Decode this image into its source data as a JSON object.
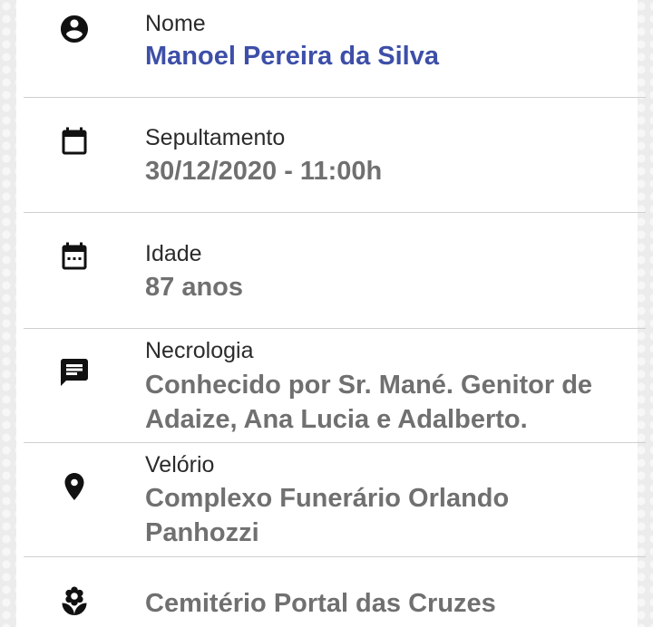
{
  "rows": [
    {
      "label": "Nome",
      "value": "Manoel Pereira da Silva",
      "icon": "account-circle-icon"
    },
    {
      "label": "Sepultamento",
      "value": "30/12/2020 - 11:00h",
      "icon": "calendar-icon"
    },
    {
      "label": "Idade",
      "value": "87 anos",
      "icon": "calendar-dots-icon"
    },
    {
      "label": "Necrologia",
      "value": "Conhecido por Sr. Mané. Genitor de Adaize, Ana Lucia e Adalberto.",
      "icon": "message-icon"
    },
    {
      "label": "Velório",
      "value": "Complexo Funerário Orlando Panhozzi",
      "icon": "location-pin-icon"
    },
    {
      "label": "",
      "value": "Cemitério Portal das Cruzes",
      "icon": "flower-icon"
    }
  ],
  "colors": {
    "name": "#3d4fa8",
    "value": "#707070",
    "label": "#2b2b2b"
  }
}
